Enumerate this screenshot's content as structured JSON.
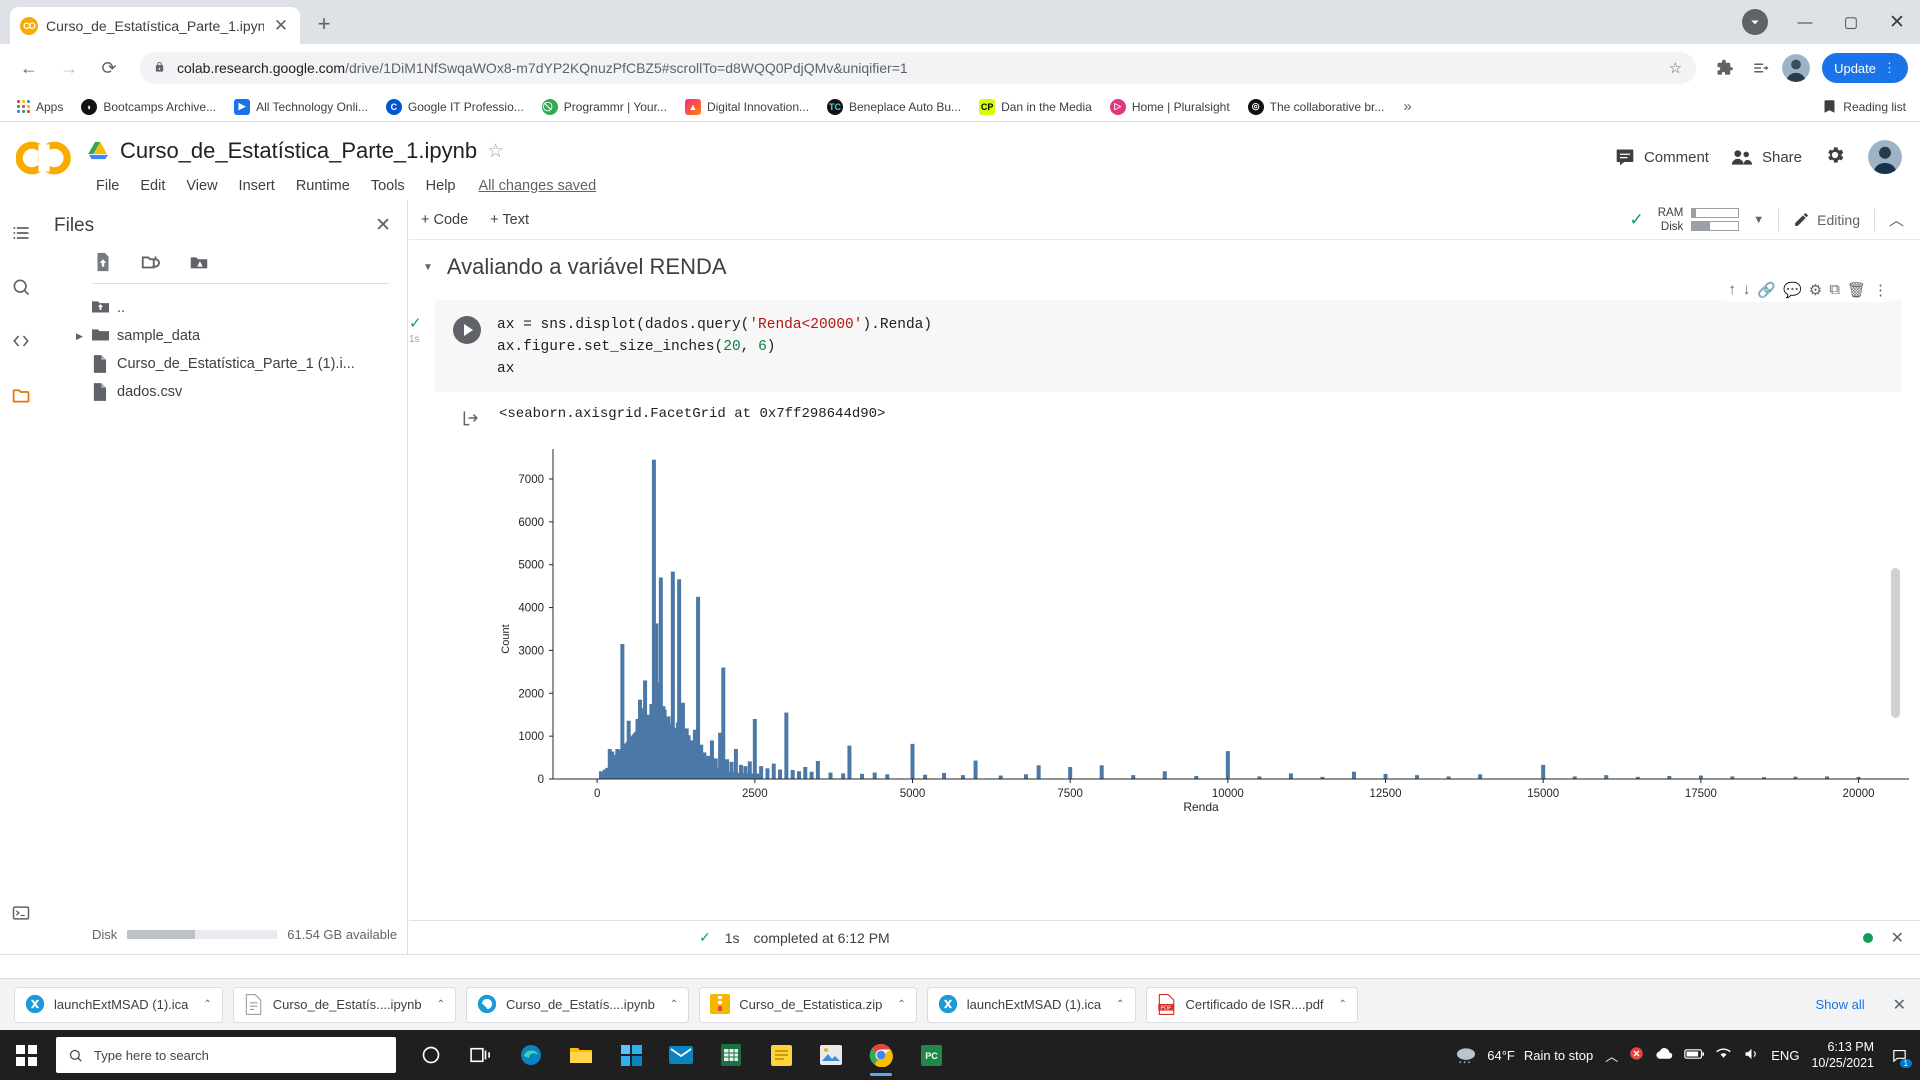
{
  "browser": {
    "tab": {
      "title": "Curso_de_Estatística_Parte_1.ipynb",
      "favicon_label": "CO",
      "close_label": "✕"
    },
    "new_tab_label": "+",
    "window_controls": {
      "minimize": "—",
      "maximize": "▢",
      "close": "✕"
    },
    "nav": {
      "back": "←",
      "forward": "→",
      "reload": "⟳"
    },
    "omnibox": {
      "lock_icon": "🔒",
      "url_domain": "colab.research.google.com",
      "url_path": "/drive/1DiM1NfSwqaWOx8-m7dYP2KQnuzPfCBZ5#scrollTo=d8WQQ0PdjQMv&uniqifier=1",
      "star_icon": "☆"
    },
    "update_button": "Update",
    "bookmarks": [
      {
        "label": "Apps",
        "icon": "apps-grid-icon"
      },
      {
        "label": "Bootcamps Archive...",
        "icon": "flame-icon",
        "color": "#1a1a1a"
      },
      {
        "label": "All Technology Onli...",
        "icon": "play-icon",
        "color": "#1a73e8"
      },
      {
        "label": "Google IT Professio...",
        "icon": "coursera-icon",
        "color": "#0056d2"
      },
      {
        "label": "Programmr | Your...",
        "icon": "green-circle-icon",
        "color": "#34a853"
      },
      {
        "label": "Digital Innovation...",
        "icon": "dio-icon",
        "color": "#e91e63"
      },
      {
        "label": "Beneplace Auto Bu...",
        "icon": "tc-icon",
        "color": "#111111"
      },
      {
        "label": "Dan in the Media",
        "icon": "cp-icon",
        "color": "#d6ff00"
      },
      {
        "label": "Home | Pluralsight",
        "icon": "pluralsight-icon",
        "color": "#e4357d"
      },
      {
        "label": "The collaborative br...",
        "icon": "spiral-icon",
        "color": "#1a1a1a"
      }
    ],
    "bookmarks_overflow": "»",
    "reading_list": "Reading list"
  },
  "colab": {
    "notebook_title": "Curso_de_Estatística_Parte_1.ipynb",
    "star": "☆",
    "menus": [
      "File",
      "Edit",
      "View",
      "Insert",
      "Runtime",
      "Tools",
      "Help"
    ],
    "save_status": "All changes saved",
    "header_actions": {
      "comment": "Comment",
      "share": "Share",
      "settings_icon": "gear-icon"
    },
    "toolbar": {
      "add_code": "+ Code",
      "add_text": "+ Text",
      "ram_label": "RAM",
      "disk_label": "Disk",
      "editing": "Editing",
      "collapse_icon": "chevron-up-icon",
      "dropdown_icon": "caret-down-icon"
    },
    "files_panel": {
      "title": "Files",
      "close_icon": "✕",
      "actions": [
        "upload-icon",
        "refresh-folder-icon",
        "mount-drive-icon"
      ],
      "items": [
        {
          "name": "..",
          "type": "up"
        },
        {
          "name": "sample_data",
          "type": "folder",
          "expandable": true
        },
        {
          "name": "Curso_de_Estatística_Parte_1 (1).i...",
          "type": "file"
        },
        {
          "name": "dados.csv",
          "type": "file"
        }
      ],
      "disk_label": "Disk",
      "disk_available": "61.54 GB available"
    },
    "rail_icons": [
      "toc-icon",
      "search-icon",
      "code-snippets-icon",
      "files-icon"
    ],
    "section_title": "Avaliando a variável RENDA",
    "cell": {
      "run_icon": "play-icon",
      "status_check": "✓",
      "exec_time": "1s",
      "code_lines": [
        "ax = sns.displot(dados.query('Renda<20000').Renda)",
        "ax.figure.set_size_inches(20, 6)",
        "ax"
      ],
      "tools": [
        "move-up-icon",
        "move-down-icon",
        "link-icon",
        "comment-icon",
        "settings-icon",
        "copy-icon",
        "delete-icon",
        "more-icon"
      ]
    },
    "output_text": "<seaborn.axisgrid.FacetGrid at 0x7ff298644d90>",
    "status_bar": {
      "check": "✓",
      "time": "1s",
      "message": "completed at 6:12 PM",
      "close_icon": "✕"
    }
  },
  "chart_data": {
    "type": "bar",
    "title": "",
    "xlabel": "Renda",
    "ylabel": "Count",
    "xlim": [
      -700,
      20800
    ],
    "ylim": [
      0,
      7700
    ],
    "xticks": [
      0,
      2500,
      5000,
      7500,
      10000,
      12500,
      15000,
      17500,
      20000
    ],
    "yticks": [
      0,
      1000,
      2000,
      3000,
      4000,
      5000,
      6000,
      7000
    ],
    "grid": false,
    "legend": null,
    "bar_color": "#4c78a8",
    "note": "Histogram of Renda (income) filtered to values below 20000; heavy right skew with spikes at round salary values.",
    "bars": [
      [
        60,
        180
      ],
      [
        120,
        220
      ],
      [
        160,
        260
      ],
      [
        200,
        700
      ],
      [
        240,
        640
      ],
      [
        280,
        480
      ],
      [
        320,
        700
      ],
      [
        360,
        560
      ],
      [
        400,
        3150
      ],
      [
        440,
        360
      ],
      [
        470,
        700
      ],
      [
        500,
        1360
      ],
      [
        520,
        650
      ],
      [
        545,
        820
      ],
      [
        560,
        540
      ],
      [
        580,
        760
      ],
      [
        600,
        1060
      ],
      [
        620,
        980
      ],
      [
        640,
        1400
      ],
      [
        660,
        1240
      ],
      [
        680,
        1850
      ],
      [
        700,
        1520
      ],
      [
        720,
        1650
      ],
      [
        740,
        1300
      ],
      [
        760,
        2300
      ],
      [
        780,
        1180
      ],
      [
        800,
        1500
      ],
      [
        820,
        1050
      ],
      [
        840,
        1150
      ],
      [
        860,
        1750
      ],
      [
        880,
        1400
      ],
      [
        900,
        7450
      ],
      [
        920,
        2300
      ],
      [
        940,
        3630
      ],
      [
        960,
        1580
      ],
      [
        975,
        2250
      ],
      [
        990,
        1320
      ],
      [
        1010,
        4700
      ],
      [
        1030,
        1200
      ],
      [
        1050,
        1700
      ],
      [
        1070,
        1620
      ],
      [
        1090,
        1350
      ],
      [
        1110,
        1100
      ],
      [
        1130,
        1460
      ],
      [
        1150,
        960
      ],
      [
        1170,
        1240
      ],
      [
        1200,
        4840
      ],
      [
        1230,
        980
      ],
      [
        1250,
        1100
      ],
      [
        1280,
        1320
      ],
      [
        1300,
        4660
      ],
      [
        1330,
        890
      ],
      [
        1360,
        1780
      ],
      [
        1390,
        760
      ],
      [
        1420,
        1180
      ],
      [
        1450,
        1020
      ],
      [
        1480,
        640
      ],
      [
        1510,
        900
      ],
      [
        1550,
        1150
      ],
      [
        1600,
        4250
      ],
      [
        1650,
        800
      ],
      [
        1700,
        620
      ],
      [
        1760,
        540
      ],
      [
        1820,
        900
      ],
      [
        1880,
        480
      ],
      [
        1950,
        1080
      ],
      [
        2000,
        2600
      ],
      [
        2060,
        460
      ],
      [
        2130,
        400
      ],
      [
        2200,
        700
      ],
      [
        2280,
        330
      ],
      [
        2350,
        300
      ],
      [
        2420,
        410
      ],
      [
        2500,
        1400
      ],
      [
        2600,
        300
      ],
      [
        2700,
        250
      ],
      [
        2800,
        360
      ],
      [
        2900,
        220
      ],
      [
        3000,
        1550
      ],
      [
        3100,
        210
      ],
      [
        3200,
        180
      ],
      [
        3300,
        280
      ],
      [
        3400,
        170
      ],
      [
        3500,
        420
      ],
      [
        3700,
        150
      ],
      [
        3900,
        130
      ],
      [
        4000,
        780
      ],
      [
        4200,
        120
      ],
      [
        4400,
        150
      ],
      [
        4600,
        110
      ],
      [
        5000,
        820
      ],
      [
        5200,
        100
      ],
      [
        5500,
        140
      ],
      [
        5800,
        90
      ],
      [
        6000,
        430
      ],
      [
        6400,
        80
      ],
      [
        6800,
        110
      ],
      [
        7000,
        320
      ],
      [
        7500,
        280
      ],
      [
        8000,
        320
      ],
      [
        8500,
        90
      ],
      [
        9000,
        180
      ],
      [
        9500,
        70
      ],
      [
        10000,
        650
      ],
      [
        10500,
        60
      ],
      [
        11000,
        130
      ],
      [
        11500,
        50
      ],
      [
        12000,
        170
      ],
      [
        12500,
        120
      ],
      [
        13000,
        90
      ],
      [
        13500,
        60
      ],
      [
        14000,
        110
      ],
      [
        15000,
        330
      ],
      [
        15500,
        60
      ],
      [
        16000,
        90
      ],
      [
        16500,
        50
      ],
      [
        17000,
        70
      ],
      [
        17500,
        80
      ],
      [
        18000,
        60
      ],
      [
        18500,
        45
      ],
      [
        19000,
        55
      ],
      [
        19500,
        60
      ],
      [
        20000,
        50
      ]
    ]
  },
  "downloads": [
    {
      "label": "launchExtMSAD (1).ica",
      "icon": "citrix-icon",
      "caret": "⌃"
    },
    {
      "label": "Curso_de_Estatís....ipynb",
      "icon": "doc-icon",
      "caret": "⌃"
    },
    {
      "label": "Curso_de_Estatís....ipynb",
      "icon": "colab-icon",
      "caret": "⌃"
    },
    {
      "label": "Curso_de_Estatistica.zip",
      "icon": "zip-icon",
      "caret": "⌃"
    },
    {
      "label": "launchExtMSAD (1).ica",
      "icon": "citrix-icon",
      "caret": "⌃"
    },
    {
      "label": "Certificado de ISR....pdf",
      "icon": "pdf-icon",
      "caret": "⌃"
    }
  ],
  "download_shelf": {
    "show_all": "Show all",
    "close": "✕"
  },
  "taskbar": {
    "search_placeholder": "Type here to search",
    "apps": [
      "cortana-icon",
      "task-view-icon",
      "edge-icon",
      "explorer-icon",
      "store-icon",
      "mail-icon",
      "excel-icon",
      "notes-icon",
      "photos-icon",
      "chrome-icon",
      "pc-icon"
    ],
    "weather_temp": "64°F",
    "weather_desc": "Rain to stop",
    "language": "ENG",
    "time": "6:13 PM",
    "date": "10/25/2021",
    "notification_count": "1"
  }
}
